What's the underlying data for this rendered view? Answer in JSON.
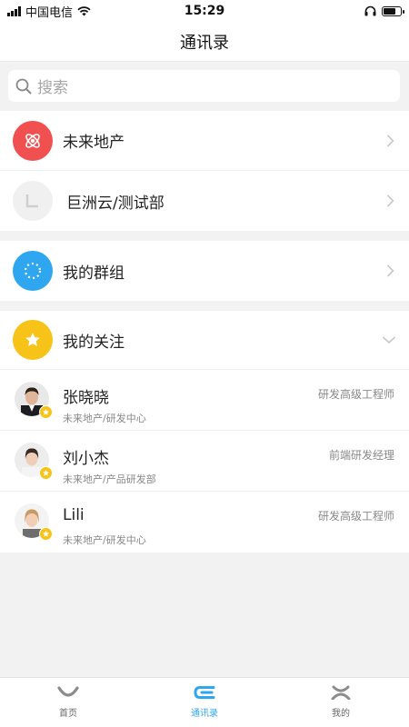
{
  "status_bar": {
    "carrier": "中国电信",
    "time": "15:29"
  },
  "nav": {
    "title": "通讯录"
  },
  "search": {
    "placeholder": "搜索"
  },
  "orgs": [
    {
      "label": "未来地产",
      "icon": "atom-icon",
      "color": "#f05050"
    },
    {
      "label": "巨洲云/测试部",
      "icon": "org-placeholder-icon",
      "color": "#f0f0f0"
    }
  ],
  "groups": {
    "label": "我的群组",
    "icon": "dotted-circle-icon",
    "color": "#2fa6f0"
  },
  "following": {
    "label": "我的关注",
    "icon": "star-icon",
    "color": "#f7c318",
    "contacts": [
      {
        "name": "张晓晓",
        "dept": "未来地产/研发中心",
        "title": "研发高级工程师"
      },
      {
        "name": "刘小杰",
        "dept": "未来地产/产品研发部",
        "title": "前端研发经理"
      },
      {
        "name": "Lili",
        "dept": "未来地产/研发中心",
        "title": "研发高级工程师"
      }
    ]
  },
  "tabs": [
    {
      "label": "首页",
      "icon": "home-smile-icon"
    },
    {
      "label": "通讯录",
      "icon": "contacts-c-icon",
      "active": true
    },
    {
      "label": "我的",
      "icon": "profile-icon"
    }
  ],
  "colors": {
    "accent": "#2fa6f0",
    "brand_red": "#f05050",
    "star": "#f7c318"
  }
}
